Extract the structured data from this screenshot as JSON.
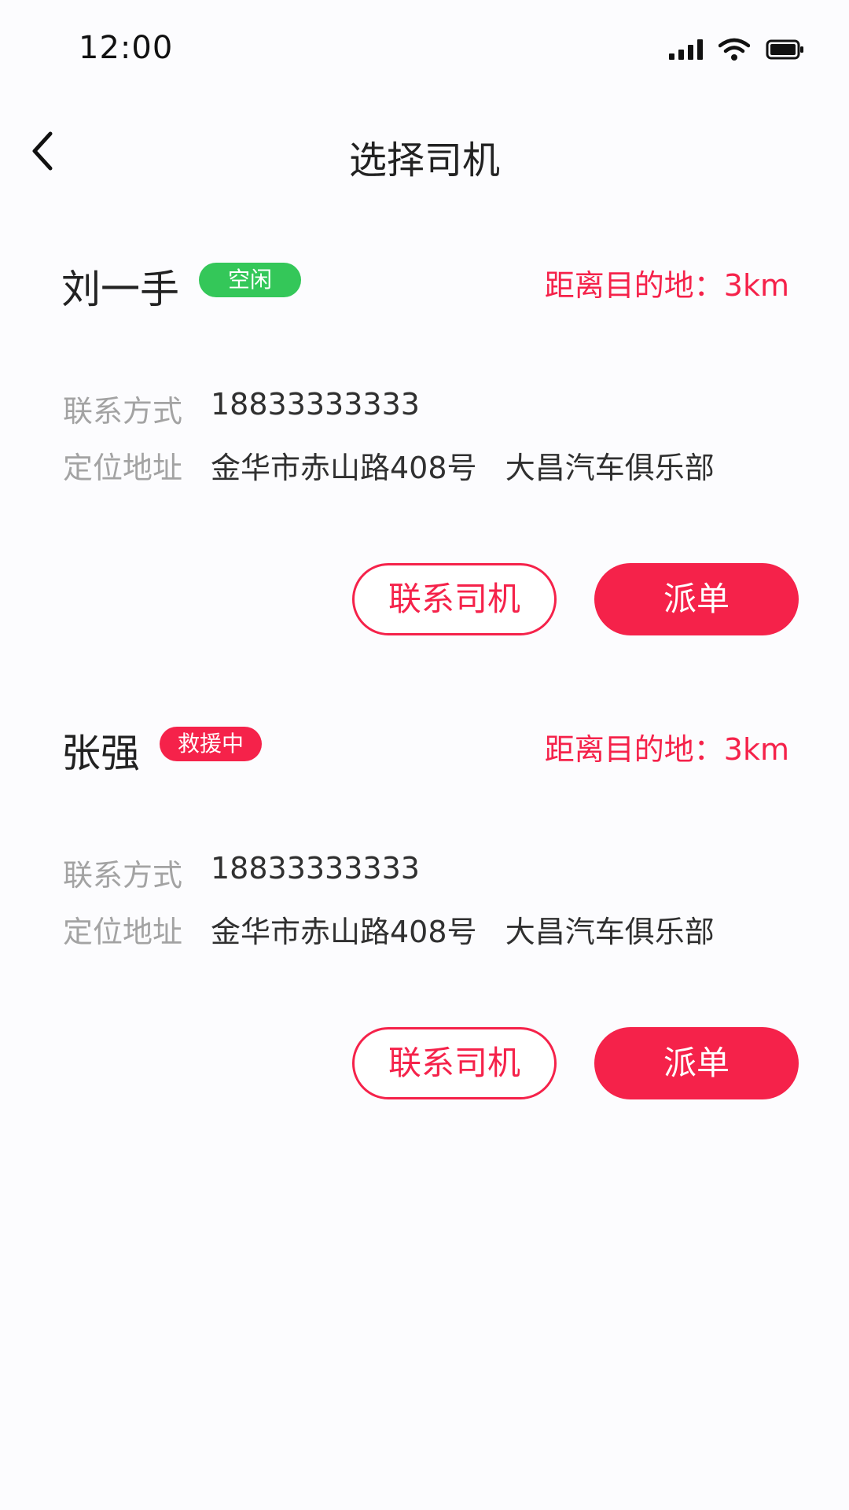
{
  "status_bar": {
    "time": "12:00",
    "icons": [
      "signal-icon",
      "wifi-icon",
      "battery-icon"
    ]
  },
  "header": {
    "back_icon": "chevron-left-icon",
    "title": "选择司机"
  },
  "colors": {
    "accent": "#f5224a",
    "idle": "#34c759",
    "label": "#a3a3a3"
  },
  "drivers": [
    {
      "name": "刘一手",
      "status": "空闲",
      "distance": "距离目的地：3km",
      "contact_label": "联系方式",
      "contact_value": "18833333333",
      "address_label": "定位地址",
      "address_value": "金华市赤山路408号   大昌汽车俱乐部",
      "contact_button": "联系司机",
      "dispatch_button": "派单"
    },
    {
      "name": "张强",
      "status": "救援中",
      "distance": "距离目的地：3km",
      "contact_label": "联系方式",
      "contact_value": "18833333333",
      "address_label": "定位地址",
      "address_value": "金华市赤山路408号   大昌汽车俱乐部",
      "contact_button": "联系司机",
      "dispatch_button": "派单"
    }
  ]
}
